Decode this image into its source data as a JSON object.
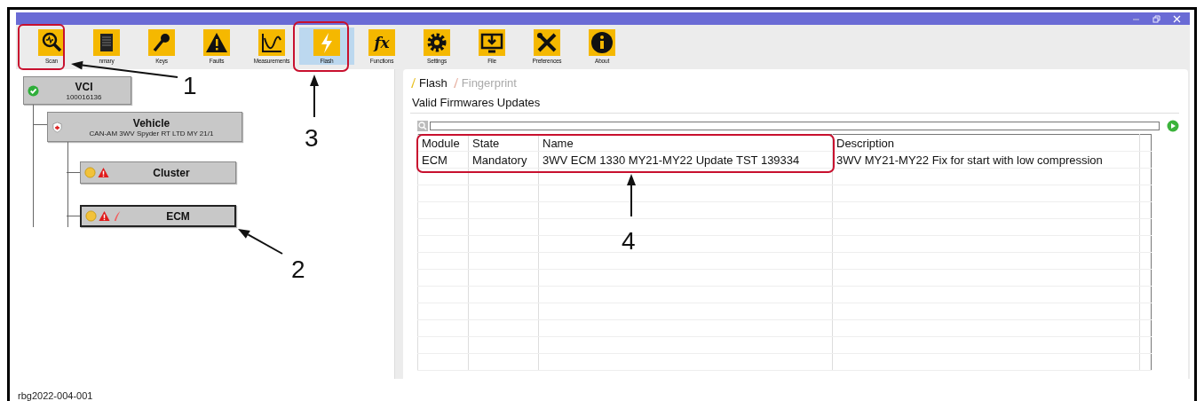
{
  "toolbar": [
    {
      "kind": "scan",
      "label": "Scan",
      "selected": false
    },
    {
      "kind": "summary",
      "label": "nmary",
      "selected": false
    },
    {
      "kind": "keys",
      "label": "Keys",
      "selected": false
    },
    {
      "kind": "faults",
      "label": "Faults",
      "selected": false
    },
    {
      "kind": "measurements",
      "label": "Measurements",
      "selected": false
    },
    {
      "kind": "flash",
      "label": "Flash",
      "selected": true
    },
    {
      "kind": "functions",
      "label": "Functions",
      "glyph": "fx",
      "selected": false
    },
    {
      "kind": "settings",
      "label": "Settings",
      "selected": false
    },
    {
      "kind": "file",
      "label": "File",
      "selected": false
    },
    {
      "kind": "preferences",
      "label": "Preferences",
      "selected": false
    },
    {
      "kind": "about",
      "label": "About",
      "selected": false
    }
  ],
  "tree": [
    {
      "kind": "interface",
      "title": "VCI",
      "subtitle": "100016136",
      "connected": true,
      "selected": false,
      "children": [
        {
          "kind": "vehicle",
          "title": "Vehicle",
          "subtitle": "CAN-AM 3WV Spyder RT LTD MY 21/1",
          "selected": false,
          "children": [
            {
              "title": "Cluster",
              "pending": true,
              "fault": true,
              "flashable": false,
              "selected": false
            },
            {
              "title": "ECM",
              "pending": true,
              "fault": true,
              "flashable": true,
              "selected": true
            }
          ]
        }
      ]
    }
  ],
  "tabs": [
    {
      "label": "Flash",
      "selected": true
    },
    {
      "label": "Fingerprint",
      "selected": false
    }
  ],
  "group_title": "Valid Firmwares Updates",
  "table": {
    "columns": [
      "Module",
      "State",
      "Name",
      "Description"
    ],
    "rows": [
      [
        "ECM",
        "Mandatory",
        "3WV ECM 1330 MY21-MY22 Update TST 139334",
        "3WV MY21-MY22 Fix for start with low compression"
      ]
    ]
  },
  "callouts": [
    {
      "label": "1"
    },
    {
      "label": "2"
    },
    {
      "label": "3"
    },
    {
      "label": "4"
    }
  ],
  "caption": "rbg2022-004-001"
}
